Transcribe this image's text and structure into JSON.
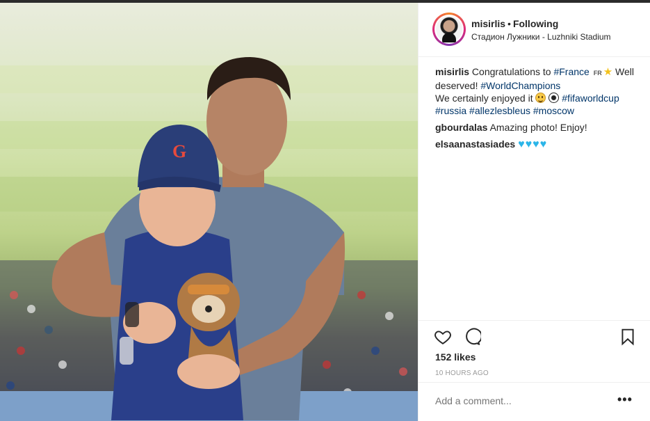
{
  "post": {
    "username": "misirlis",
    "separator": "•",
    "follow_state": "Following",
    "location": "Стадион Лужники - Luzhniki Stadium"
  },
  "caption": {
    "user": "misirlis",
    "text_1": "Congratulations to",
    "tag_france": "#France",
    "flag_label": "FR",
    "text_2": "Well deserved!",
    "tag_worldchampions": "#WorldChampions",
    "text_3": "We certainly enjoyed it",
    "tag_fifaworldcup": "#fifaworldcup",
    "tag_russia": "#russia",
    "tag_allezlesbleus": "#allezlesbleus",
    "tag_moscow": "#moscow"
  },
  "comments": [
    {
      "user": "gbourdalas",
      "text": "Amazing photo! Enjoy!"
    },
    {
      "user": "elsaanastasiades",
      "text": ""
    }
  ],
  "icons": {
    "star": "★",
    "hearts": "♥♥♥♥"
  },
  "engagement": {
    "likes": "152 likes",
    "timestamp": "10 HOURS AGO"
  },
  "composer": {
    "placeholder": "Add a comment...",
    "more": "•••"
  },
  "colors": {
    "hashtag": "#003569",
    "text": "#262626",
    "muted": "#999999",
    "border": "#efefef"
  }
}
